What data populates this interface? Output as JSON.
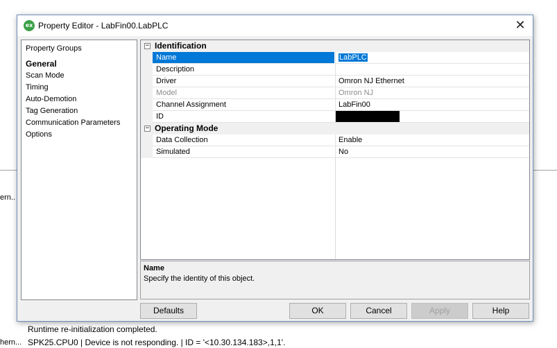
{
  "window": {
    "title": "Property Editor - LabFin00.LabPLC",
    "icon_text": "ex",
    "close_glyph": "✕"
  },
  "groups": {
    "title": "Property Groups",
    "items": [
      "General",
      "Scan Mode",
      "Timing",
      "Auto-Demotion",
      "Tag Generation",
      "Communication Parameters",
      "Options"
    ],
    "active": "General"
  },
  "categories": {
    "identification": {
      "label": "Identification",
      "toggle": "−",
      "props": [
        {
          "name": "Name",
          "value": "LabPLC"
        },
        {
          "name": "Description",
          "value": ""
        },
        {
          "name": "Driver",
          "value": "Omron NJ Ethernet"
        },
        {
          "name": "Model",
          "value": "Omron NJ"
        },
        {
          "name": "Channel Assignment",
          "value": "LabFin00"
        },
        {
          "name": "ID",
          "value": ""
        }
      ]
    },
    "operating_mode": {
      "label": "Operating Mode",
      "toggle": "−",
      "props": [
        {
          "name": "Data Collection",
          "value": "Enable"
        },
        {
          "name": "Simulated",
          "value": "No"
        }
      ]
    }
  },
  "description": {
    "title": "Name",
    "text": "Specify the identity of this object."
  },
  "buttons": {
    "defaults": "Defaults",
    "ok": "OK",
    "cancel": "Cancel",
    "apply": "Apply",
    "help": "Help"
  },
  "background": {
    "frag1": "ern..",
    "frag2": "hern...",
    "log1": "Runtime re-initialization completed.",
    "log2": "SPK25.CPU0 | Device is not responding. | ID = '<10.30.134.183>,1,1'."
  },
  "colors": {
    "selection": "#0078d7",
    "app_icon": "#3aa047"
  }
}
